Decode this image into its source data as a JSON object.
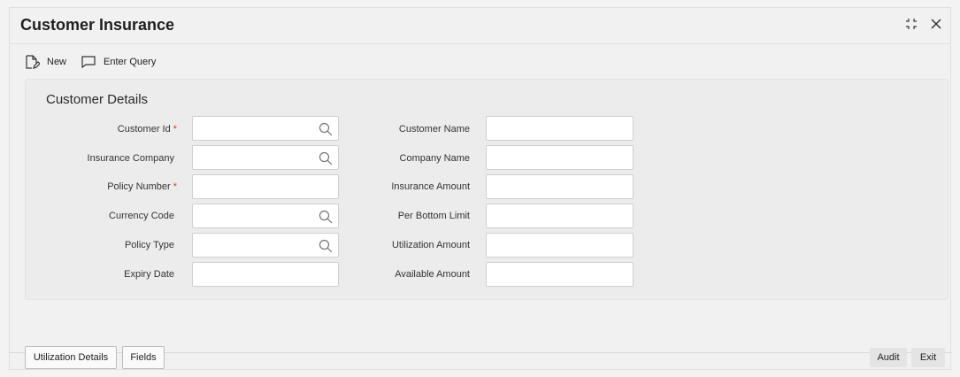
{
  "window": {
    "title": "Customer Insurance"
  },
  "toolbar": {
    "new_label": "New",
    "enter_query_label": "Enter Query"
  },
  "section": {
    "title": "Customer Details"
  },
  "fields_left": [
    {
      "label": "Customer Id",
      "required": "*",
      "value": "",
      "lookup": true
    },
    {
      "label": "Insurance Company",
      "required": "",
      "value": "",
      "lookup": true
    },
    {
      "label": "Policy Number",
      "required": "*",
      "value": "",
      "lookup": false
    },
    {
      "label": "Currency Code",
      "required": "",
      "value": "",
      "lookup": true
    },
    {
      "label": "Policy Type",
      "required": "",
      "value": "",
      "lookup": true
    },
    {
      "label": "Expiry Date",
      "required": "",
      "value": "",
      "lookup": false
    }
  ],
  "fields_right": [
    {
      "label": "Customer Name",
      "value": ""
    },
    {
      "label": "Company Name",
      "value": ""
    },
    {
      "label": "Insurance Amount",
      "value": ""
    },
    {
      "label": "Per Bottom Limit",
      "value": ""
    },
    {
      "label": "Utilization Amount",
      "value": ""
    },
    {
      "label": "Available Amount",
      "value": ""
    }
  ],
  "footer": {
    "tabs": [
      "Utilization Details",
      "Fields"
    ],
    "audit_label": "Audit",
    "exit_label": "Exit"
  },
  "colors": {
    "required": "#d0421b",
    "background": "#f1f1f1"
  }
}
